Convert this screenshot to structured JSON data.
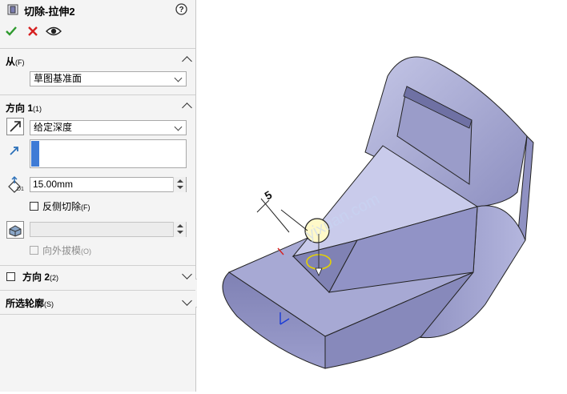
{
  "feature": {
    "title": "切除-拉伸2",
    "icon": "cut-extrude-icon",
    "help_icon": "help-icon"
  },
  "actions": {
    "ok_icon": "check-icon",
    "cancel_icon": "close-icon",
    "preview_icon": "eye-icon"
  },
  "from": {
    "header": "从",
    "shortcut": "(F)",
    "value": "草图基准面"
  },
  "direction1": {
    "header": "方向 1",
    "shortcut": "(1)",
    "end_condition": "给定深度",
    "depth": "15.00mm",
    "flip_side_label": "反侧切除",
    "flip_side_shortcut": "(F)",
    "draft_outward_label": "向外拔模",
    "draft_outward_shortcut": "(O)"
  },
  "direction2": {
    "header": "方向 2",
    "shortcut": "(2)"
  },
  "contours": {
    "header": "所选轮廓",
    "shortcut": "(S)"
  },
  "viewport": {
    "dimension_label": "5",
    "watermark": "yixuan.com"
  },
  "colors": {
    "part_face": "#9fa1cc",
    "part_dark": "#7b7db0",
    "accent": "#3e7bd6",
    "ok": "#2e9a2e",
    "cancel": "#d62020"
  }
}
